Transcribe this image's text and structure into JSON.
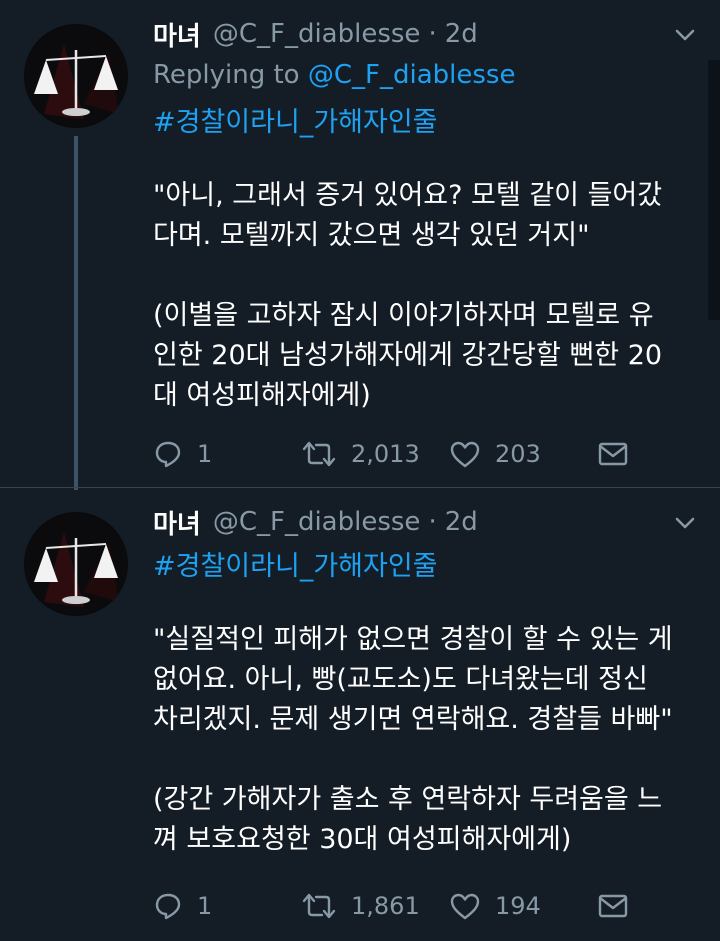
{
  "tweets": [
    {
      "display_name": "마녀",
      "handle": "@C_F_diablesse",
      "separator": "·",
      "time": "2d",
      "replying_prefix": "Replying to",
      "replying_to": "@C_F_diablesse",
      "hashtag": "#경찰이라니_가해자인줄",
      "quote_lines": [
        "\"아니, 그래서 증거 있어요? 모텔 같이 들어갔",
        "다며. 모텔까지 갔으면 생각 있던 거지\""
      ],
      "context_lines": [
        "(이별을 고하자 잠시 이야기하자며 모텔로 유",
        "인한 20대 남성가해자에게 강간당할 뻔한 20",
        "대 여성피해자에게)"
      ],
      "replies": "1",
      "retweets": "2,013",
      "likes": "203",
      "icons": {
        "reply": "reply-icon",
        "retweet": "retweet-icon",
        "like": "heart-icon",
        "dm": "envelope-icon",
        "menu": "chevron-down-icon"
      }
    },
    {
      "display_name": "마녀",
      "handle": "@C_F_diablesse",
      "separator": "·",
      "time": "2d",
      "hashtag": "#경찰이라니_가해자인줄",
      "quote_lines": [
        "\"실질적인 피해가 없으면 경찰이 할 수 있는 게",
        "없어요. 아니, 빵(교도소)도 다녀왔는데 정신",
        "차리겠지. 문제 생기면 연락해요. 경찰들 바빠\""
      ],
      "context_lines": [
        "(강간 가해자가 출소 후 연락하자 두려움을 느",
        "껴 보호요청한 30대 여성피해자에게)"
      ],
      "replies": "1",
      "retweets": "1,861",
      "likes": "194",
      "icons": {
        "reply": "reply-icon",
        "retweet": "retweet-icon",
        "like": "heart-icon",
        "dm": "envelope-icon",
        "menu": "chevron-down-icon"
      }
    }
  ],
  "colors": {
    "background": "#141d26",
    "accent": "#1da1f2",
    "muted": "#8899a6",
    "divider": "#38444d"
  }
}
